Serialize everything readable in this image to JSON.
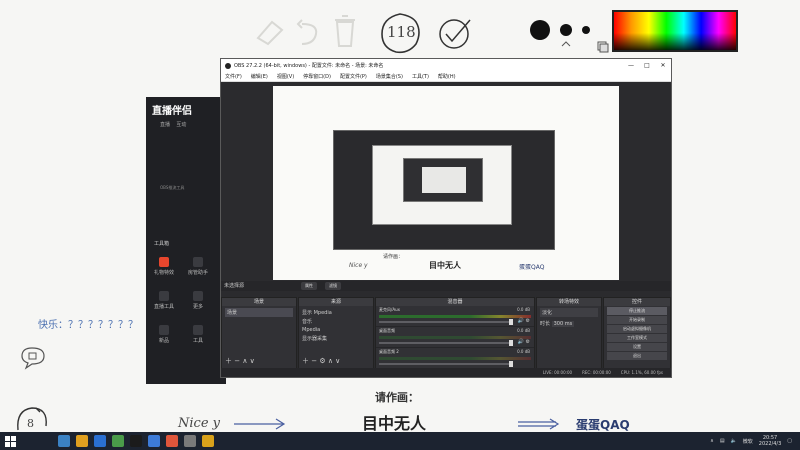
{
  "board": {
    "sticker_number": "118",
    "happy_label": "快乐：？？？？？？？",
    "please_draw": "请作画：",
    "nice_text": "Nice y",
    "arrow_text_1": "→",
    "big_text": "目中无人",
    "arrow_text_2": "⟹",
    "dandan_text": "蛋蛋QAQ",
    "number_8": "8",
    "icons": [
      "eraser-icon",
      "undo-icon",
      "trash-icon",
      "check-circle-icon",
      "brush-size-large-icon",
      "brush-size-medium-icon",
      "brush-size-small-icon",
      "color-palette",
      "copy-icon"
    ]
  },
  "side_app": {
    "logo": "直播伴侣",
    "tabs": [
      "直播",
      "互动"
    ],
    "hint": "OBS推流工具",
    "tools_title": "工具箱",
    "tools": [
      {
        "label": "礼物特效",
        "active": true
      },
      {
        "label": "房管助手",
        "active": false
      },
      {
        "label": "直播工具",
        "active": false
      },
      {
        "label": "更多",
        "active": false
      },
      {
        "label": "新品",
        "active": false
      },
      {
        "label": "工具",
        "active": false
      }
    ]
  },
  "obs": {
    "title": "OBS 27.2.2 (64-bit, windows) - 配置文件: 未命名 - 场景: 未命名",
    "menu": [
      "文件(F)",
      "编辑(E)",
      "视图(V)",
      "停靠窗口(D)",
      "配置文件(P)",
      "场景集合(S)",
      "工具(T)",
      "帮助(H)"
    ],
    "active_scene_label": "未选择源",
    "properties_btn": "属性",
    "filters_btn": "滤镜",
    "docks": {
      "scenes": {
        "title": "场景",
        "items": [
          "场景"
        ]
      },
      "sources": {
        "title": "来源",
        "items": [
          "显示 Mpedia",
          "音乐",
          "Mpedia",
          "显示器采集"
        ]
      },
      "mixer": {
        "title": "混音器",
        "channels": [
          {
            "name": "麦克风/Aux",
            "db": "0.0 dB"
          },
          {
            "name": "桌面音频",
            "db": "0.0 dB"
          },
          {
            "name": "桌面音频 2",
            "db": "0.0 dB"
          }
        ]
      },
      "transitions": {
        "title": "转场特效",
        "type": "淡化",
        "duration_label": "时长",
        "duration": "300 ms"
      },
      "controls": {
        "title": "控件",
        "buttons": [
          "停止推流",
          "开始录制",
          "启动虚拟摄像机",
          "工作室模式",
          "设置",
          "退出"
        ]
      }
    },
    "status": {
      "live": "LIVE: 00:00:00",
      "rec": "REC: 00:00:00",
      "cpu": "CPU: 1.1%, 60.00 fps"
    }
  },
  "taskbar": {
    "input_method": "微软",
    "time": "20:57",
    "date": "2022/4/3",
    "icon_colors": [
      "#3b82c4",
      "#e0a020",
      "#2a6fd1",
      "#4a9b4a",
      "#1b1b1b",
      "#3d7bd8",
      "#e0563b",
      "#7a7a7a",
      "#d9a21b"
    ]
  }
}
